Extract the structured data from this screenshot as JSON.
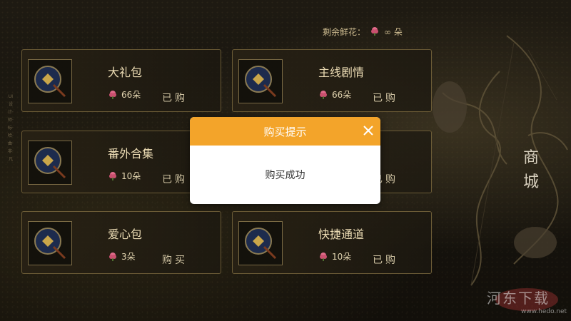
{
  "stock": {
    "label": "剩余鲜花：",
    "value": "∞ 朵"
  },
  "shop_title": [
    "商",
    "城"
  ],
  "side_text": "UI设计·师·标·哈·曲·非·凡",
  "items": [
    {
      "title": "大礼包",
      "price": "66朵",
      "action": "已购"
    },
    {
      "title": "主线剧情",
      "price": "66朵",
      "action": "已购"
    },
    {
      "title": "番外合集",
      "price": "10朵",
      "action": "已购"
    },
    {
      "title": "",
      "price": "",
      "action": "已购"
    },
    {
      "title": "爱心包",
      "price": "3朵",
      "action": "购买"
    },
    {
      "title": "快捷通道",
      "price": "10朵",
      "action": "已购"
    }
  ],
  "dialog": {
    "title": "购买提示",
    "message": "购买成功"
  },
  "watermark": {
    "text": "河东下载",
    "url": "www.hedo.net"
  },
  "colors": {
    "accent": "#f3a42a",
    "card_border": "#6b5b36",
    "flower": "#e06b8a"
  }
}
